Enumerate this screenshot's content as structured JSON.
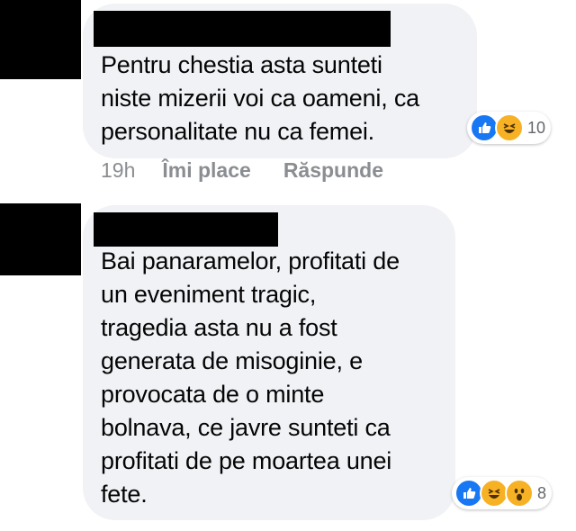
{
  "comments": [
    {
      "text": "Pentru chestia asta sunteti\nniste mizerii voi ca oameni, ca\npersonalitate nu ca femei.",
      "time": "19h",
      "like_label": "Îmi place",
      "reply_label": "Răspunde",
      "reaction_count": "10",
      "reaction_icons": [
        "like-icon",
        "haha-icon"
      ]
    },
    {
      "text": "Bai panaramelor, profitati de\nun eveniment tragic,\ntragedia asta nu a fost\ngenerata de misoginie, e\nprovocata de o minte\nbolnava, ce javre sunteti ca\nprofitati de pe moartea unei\nfete.",
      "reaction_count": "8",
      "reaction_icons": [
        "like-icon",
        "haha-icon",
        "wow-icon"
      ]
    }
  ],
  "colors": {
    "bubble": "#f0f2f5",
    "meta_text": "#8a8d91",
    "like_blue": "#1877f2",
    "emoji_yellow": "#f7b125"
  }
}
